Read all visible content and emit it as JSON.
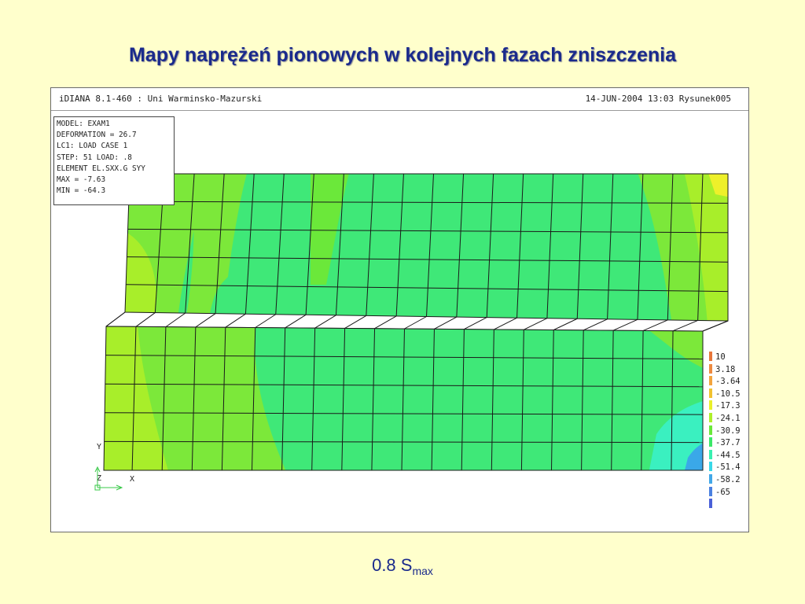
{
  "slide": {
    "title": "Mapy naprężeń pionowych w kolejnych fazach zniszczenia",
    "caption_main": "0.8 S",
    "caption_sub": "max"
  },
  "window": {
    "header_left": "iDIANA 8.1-460 : Uni Warminsko-Mazurski",
    "header_right": "14-JUN-2004 13:03 Rysunek005"
  },
  "info": {
    "lines": [
      "MODEL: EXAM1",
      "DEFORMATION = 26.7",
      "LC1: LOAD CASE 1",
      "STEP: 51  LOAD: .8",
      "ELEMENT EL.SXX.G SYY",
      "MAX = -7.63",
      "MIN = -64.3"
    ]
  },
  "legend": {
    "items": [
      {
        "label": "10",
        "color": "#e8763a"
      },
      {
        "label": "3.18",
        "color": "#ee8a40"
      },
      {
        "label": "-3.64",
        "color": "#f3a43e"
      },
      {
        "label": "-10.5",
        "color": "#f2c230"
      },
      {
        "label": "-17.3",
        "color": "#eaf02a"
      },
      {
        "label": "-24.1",
        "color": "#aef02a"
      },
      {
        "label": "-30.9",
        "color": "#6be83a"
      },
      {
        "label": "-37.7",
        "color": "#3be868"
      },
      {
        "label": "-44.5",
        "color": "#38f0b0"
      },
      {
        "label": "-51.4",
        "color": "#38d8e8"
      },
      {
        "label": "-58.2",
        "color": "#42a8e8"
      },
      {
        "label": "-65",
        "color": "#4a80e0"
      },
      {
        "label": "",
        "color": "#4a60d8"
      }
    ]
  },
  "axes": {
    "y": "Y",
    "z": "Z",
    "x": "X"
  },
  "colors": {
    "green": "#3fe878",
    "light_green": "#7ce83a",
    "yellow_green": "#a8ee2a",
    "cyan": "#3af0c0",
    "blue": "#3aa8e8",
    "yellow": "#eef02a",
    "mesh": "#1a1a1a"
  }
}
